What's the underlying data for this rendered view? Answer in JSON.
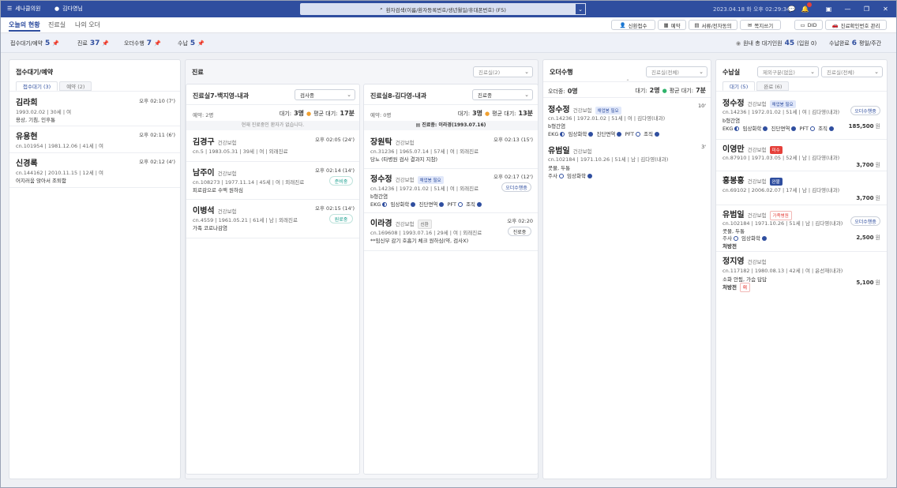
{
  "topbar": {
    "hospital": "세나클의원",
    "user": "김다영님",
    "search_placeholder": "환자검색(이름/환자등록번호/생년월일/휴대폰번호) (F5)",
    "datetime": "2023.04.18 화 오후 02:29:34",
    "notif_count": "1"
  },
  "tabs": [
    "오늘의 현황",
    "진료실",
    "나의 오더"
  ],
  "quick": [
    "신환접수",
    "예약",
    "서류/전자동의",
    "쪽지쓰기",
    "DID",
    "진료확인번호 관리"
  ],
  "stats": {
    "reception_label": "접수대기/예약",
    "reception": "5",
    "treat_label": "진료",
    "treat": "37",
    "order_label": "오더수행",
    "order": "7",
    "pay_label": "수납",
    "pay": "5",
    "waiting_label": "원내 총 대기인원",
    "waiting": "45",
    "waiting_sub": "(입원 0)",
    "done_label": "수납완료",
    "done": "6",
    "period": "평일/주간"
  },
  "reception": {
    "title": "접수대기/예약",
    "tab1": "접수대기 (3)",
    "tab2": "예약 (2)",
    "items": [
      {
        "name": "김라희",
        "time": "오후 02:10 (7')",
        "meta": "1993.02.02 | 30세 | 여",
        "note": "용상,  기침,  인후통"
      },
      {
        "name": "유용현",
        "time": "오후 02:11 (6')",
        "meta": "cn.101954 | 1981.12.06 | 41세 | 여",
        "note": ""
      },
      {
        "name": "신경록",
        "time": "오후 02:12 (4')",
        "meta": "cn.144162 | 2010.11.15 | 12세 | 여",
        "note": "어지러움 앉아서 조퇴함"
      }
    ]
  },
  "treat": {
    "title": "진료",
    "room_select": "진료실(2)",
    "room1": {
      "title": "진료실7-백지영-내과",
      "status": "검사중",
      "reserve": "예약: 2명",
      "wait_label": "대기:",
      "wait": "3명",
      "avg_label": "평균 대기:",
      "avg": "17분",
      "empty": "현재 진료중인 환자가 없습니다.",
      "patients": [
        {
          "name": "김경구",
          "ins": "건강보험",
          "time": "오후 02:05 (24')",
          "meta": "cn.5 | 1983.05.31 | 39세 | 여 | 외래진료",
          "note": "",
          "btn": ""
        },
        {
          "name": "남주이",
          "ins": "건강보험",
          "time": "오후 02:14 (14')",
          "meta": "cn.108273 | 1977.11.14 | 45세 | 여 | 외래진료",
          "note": "피로감으로 수액 원하심",
          "btn": "준비중"
        },
        {
          "name": "이병석",
          "ins": "건강보험",
          "time": "오후 02:15 (14')",
          "meta": "cn.4559 | 1961.05.21 | 61세 | 남 | 외래진료",
          "note": "가족 코로나감염",
          "btn": "원료중"
        }
      ]
    },
    "room2": {
      "title": "진료실8-김다영-내과",
      "status": "진료중",
      "reserve": "예약: 0명",
      "wait_label": "대기:",
      "wait": "3명",
      "avg_label": "평균 대기:",
      "avg": "13분",
      "current": "진료중: 이라경(1993.07.16)",
      "patients": [
        {
          "name": "장원탁",
          "ins": "건강보험",
          "time": "오후 02:13 (15')",
          "meta": "cn.31236 | 1965.07.14 | 57세 | 여 | 외래진료",
          "note": "당뇨 (타병원 검사 결과지 지참)",
          "tag": "",
          "btn": ""
        },
        {
          "name": "정수정",
          "ins": "건강보험",
          "time": "오후 02:17 (12')",
          "meta": "cn.14236 | 1972.01.02 | 51세 | 여 | 외래진료",
          "note": "b형간염",
          "tag": "채업봉 필요",
          "btn": "오더수행중"
        },
        {
          "name": "이라경",
          "ins": "건강보험",
          "time": "오후 02:20",
          "meta": "cn.169608 | 1993.07.16 | 29세 | 여 | 외래진료",
          "note": "**임신부 감기 호흡기 체크 원하심(약, 검사X)",
          "tag": "신환",
          "btn": "진료중"
        }
      ]
    }
  },
  "orders": {
    "title": "오더수행",
    "room_select": "진료실(전체)",
    "count_label": "오더중:",
    "count": "0명",
    "wait_label": "대기:",
    "wait": "2명",
    "avg_label": "평균 대기:",
    "avg": "7분",
    "items": [
      {
        "name": "정수정",
        "ins": "건강보험",
        "tag": "채업봉 필요",
        "mins": "10'",
        "meta": "cn.14236 | 1972.01.02 | 51세 | 여 | 김다영(내과)",
        "note": "b형간염"
      },
      {
        "name": "유범일",
        "ins": "건강보험",
        "tag": "",
        "mins": "3'",
        "meta": "cn.102184 | 1971.10.26 | 51세 | 남 | 김다영(내과)",
        "note": "콧물, 두통"
      }
    ]
  },
  "payment": {
    "title": "수납실",
    "select1": "제외구분(없음)",
    "select2": "진료실(전체)",
    "tab1": "대기 (5)",
    "tab2": "완료 (6)",
    "currency": "원",
    "items": [
      {
        "name": "정수정",
        "ins": "건강보험",
        "tag": "채업봉 필요",
        "meta": "cn.14236 | 1972.01.02 | 51세 | 여 | 김다영(내과)",
        "note": "b형간염",
        "amount": "185,500",
        "btn": "오더수행중"
      },
      {
        "name": "이영만",
        "ins": "건강보험",
        "tag": "미수",
        "meta": "cn.87910 | 1971.03.05 | 52세 | 남 | 김다영(내과)",
        "note": "",
        "amount": "3,700",
        "btn": ""
      },
      {
        "name": "홍봉홍",
        "ins": "건강보험",
        "tag": "완불",
        "meta": "cn.69102 | 2006.02.07 | 17세 | 남 | 김다영(내과)",
        "note": "",
        "amount": "3,700",
        "btn": ""
      },
      {
        "name": "유범일",
        "ins": "건강보험",
        "tag": "가족병원",
        "meta": "cn.102184 | 1971.10.26 | 51세 | 남 | 김다영(내과)",
        "note": "콧물, 두통",
        "amount": "2,500",
        "btn": "오더수행중"
      },
      {
        "name": "정지영",
        "ins": "건강보험",
        "tag": "",
        "meta": "cn.117182 | 1980.08.13 | 42세 | 여 | 윤선재(내과)",
        "note": "소화 안됨, 가슴 답답",
        "amount": "5,100",
        "btn": ""
      }
    ]
  },
  "orderlines": {
    "a": [
      "EKG",
      "임상화학",
      "진단면역",
      "PFT",
      "조직"
    ],
    "b": [
      "주사",
      "임상화학"
    ]
  },
  "rx": {
    "label": "처방전",
    "tag": "미"
  }
}
